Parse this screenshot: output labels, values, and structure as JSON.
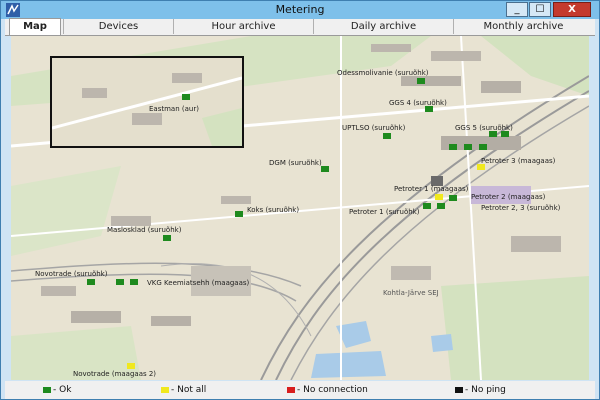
{
  "window": {
    "title": "Metering",
    "app_icon": "network-icon",
    "min_glyph": "_",
    "max_glyph": "☐",
    "close_glyph": "X"
  },
  "tabs": [
    {
      "label": "Map",
      "active": true
    },
    {
      "label": "Devices",
      "active": false
    },
    {
      "label": "Hour archive",
      "active": false
    },
    {
      "label": "Daily archive",
      "active": false
    },
    {
      "label": "Monthly archive",
      "active": false
    }
  ],
  "colors": {
    "ok": "#1e8a1e",
    "not_all": "#f0e81e",
    "no_connection": "#d81e1e",
    "no_ping": "#111111"
  },
  "map": {
    "inset_label": "Eastman (aur)",
    "place_label": "Kohtla-Järve SEJ",
    "labels": {
      "odessmolivanie": "Odessmolivanie (suruõhk)",
      "ggs4": "GGS 4 (suruõhk)",
      "uptlso": "UPTLSO (suruõhk)",
      "ggs5": "GGS 5 (suruõhk)",
      "dgm": "DGM (suruõhk)",
      "petroter3": "Petroter 3 (maagaas)",
      "petroter1m": "Petroter 1 (maagaas)",
      "petroter2m": "Petroter 2 (maagaas)",
      "petroter1s": "Petroter 1 (suruõhk)",
      "petroter23": "Petroter 2, 3 (suruõhk)",
      "koks": "Koks (suruõhk)",
      "maslosklad": "Maslosklad (suruõhk)",
      "novotrade": "Novotrade (suruõhk)",
      "vkg": "VKG Keemiatsehh (maagaas)",
      "novotrade2": "Novotrade (maagaas 2)"
    }
  },
  "legend": {
    "ok": "- Ok",
    "not_all": "- Not all",
    "no_connection": "- No connection",
    "no_ping": "- No ping"
  }
}
